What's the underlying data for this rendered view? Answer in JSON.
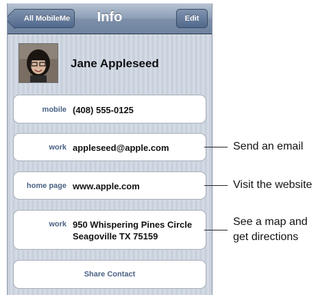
{
  "navbar": {
    "back_label": "All MobileMe",
    "title": "Info",
    "edit_label": "Edit"
  },
  "contact": {
    "name": "Jane Appleseed"
  },
  "fields": [
    {
      "label": "mobile",
      "value": "(408) 555-0125"
    },
    {
      "label": "work",
      "value": "appleseed@apple.com"
    },
    {
      "label": "home page",
      "value": "www.apple.com"
    },
    {
      "label": "work",
      "address_line1": "950 Whispering Pines Circle",
      "address_line2": "Seagoville TX 75159"
    }
  ],
  "share_label": "Share Contact",
  "callouts": {
    "email": "Send an email",
    "website": "Visit the website",
    "map_line1": "See a map and",
    "map_line2": "get directions"
  }
}
